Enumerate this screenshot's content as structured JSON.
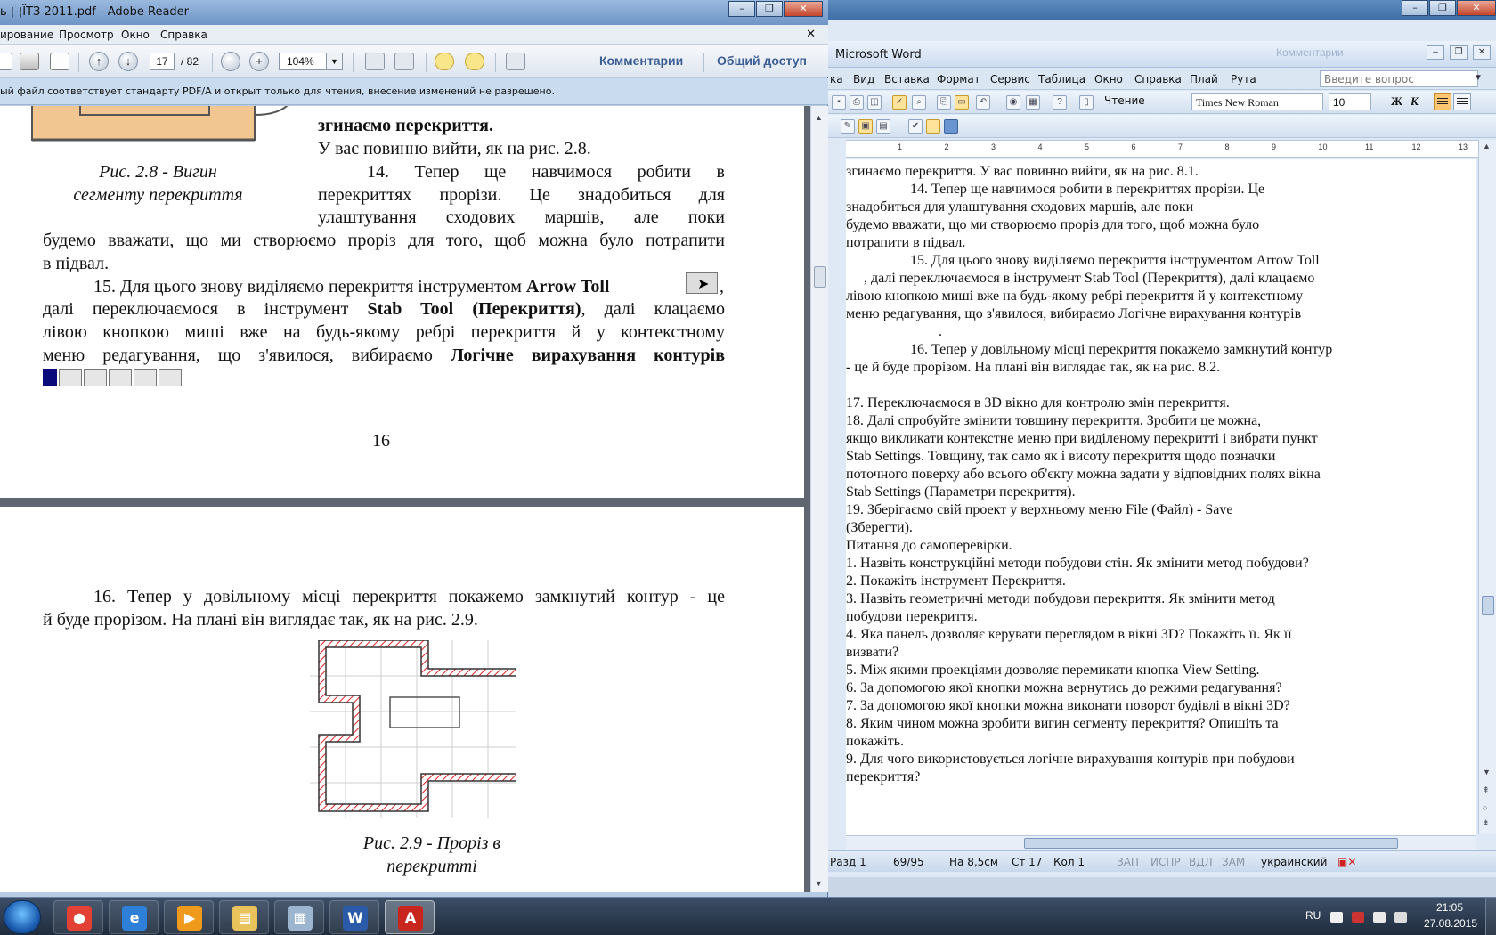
{
  "word": {
    "title": "Microsoft Word",
    "ghost_label": "Комментарии",
    "question_placeholder": "Введите вопрос",
    "menu": [
      "ка",
      "Вид",
      "Вставка",
      "Формат",
      "Сервис",
      "Таблица",
      "Окно",
      "Справка",
      "Плай",
      "Рута"
    ],
    "reading_label": "Чтение",
    "font_name": "Times New Roman",
    "font_size": "10",
    "bold_label": "Ж",
    "italic_label": "К",
    "ruler": [
      "1",
      "2",
      "3",
      "4",
      "5",
      "6",
      "7",
      "8",
      "9",
      "10",
      "11",
      "12",
      "13"
    ],
    "doc_lines": [
      {
        "text": "згинаємо перекриття. У вас повинно вийти, як на рис. 8.1.",
        "indent": false
      },
      {
        "text": "14. Тепер ще навчимося робити в перекриттях прорізи. Це",
        "indent": true
      },
      {
        "text": "знадобиться для улаштування сходових маршів, але поки",
        "indent": false
      },
      {
        "text": "будемо вважати, що ми створюємо проріз для того, щоб можна було",
        "indent": false
      },
      {
        "text": "потрапити в підвал.",
        "indent": false
      },
      {
        "text": "15. Для цього знову виділяємо перекриття інструментом Arrow Toll",
        "indent": true
      },
      {
        "text": "     , далі переключаємося в інструмент Stab Tool (Перекриття), далі клацаємо",
        "indent": false
      },
      {
        "text": "лівою кнопкою миші вже на будь-якому ребрі перекриття й у контекстному",
        "indent": false
      },
      {
        "text": "меню редагування, що з'явилося, вибираємо Логічне вирахування контурів",
        "indent": false
      },
      {
        "text": "                          .",
        "indent": false
      },
      {
        "text": "16. Тепер у довільному місці перекриття покажемо замкнутий контур",
        "indent": true
      },
      {
        "text": "- це й буде прорізом. На плані він виглядає так, як на рис. 8.2.",
        "indent": false
      },
      {
        "text": "",
        "indent": false
      },
      {
        "text": "17. Переключаємося в 3D вікно для контролю змін перекриття.",
        "indent": false
      },
      {
        "text": "18. Далі спробуйте змінити товщину перекриття. Зробити це можна,",
        "indent": false
      },
      {
        "text": "якщо викликати контекстне меню при виділеному перекритті і вибрати пункт",
        "indent": false
      },
      {
        "text": "Stab Settings. Товщину, так само як і висоту перекриття щодо позначки",
        "indent": false
      },
      {
        "text": "поточного поверху або всього об'єкту можна задати у відповідних полях вікна",
        "indent": false
      },
      {
        "text": "Stab Settings (Параметри перекриття).",
        "indent": false
      },
      {
        "text": "19. Зберігаємо свій проект у верхньому меню File (Файл) - Save",
        "indent": false
      },
      {
        "text": "(Зберегти).",
        "indent": false
      },
      {
        "text": "Питання до самоперевірки.",
        "indent": false
      },
      {
        "text": "1. Назвіть конструкційні методи побудови стін. Як змінити метод побудови?",
        "indent": false
      },
      {
        "text": "2. Покажіть інструмент Перекриття.",
        "indent": false
      },
      {
        "text": "3. Назвіть геометричні методи побудови перекриття. Як змінити метод",
        "indent": false
      },
      {
        "text": "побудови перекриття.",
        "indent": false
      },
      {
        "text": "4. Яка панель дозволяє керувати переглядом в вікні 3D? Покажіть її. Як її",
        "indent": false
      },
      {
        "text": "визвати?",
        "indent": false
      },
      {
        "text": "5. Між якими проекціями дозволяє перемикати кнопка View Setting.",
        "indent": false
      },
      {
        "text": "6. За допомогою якої кнопки можна вернутись до режими редагування?",
        "indent": false
      },
      {
        "text": "7. За допомогою якої кнопки можна виконати поворот будівлі в вікні 3D?",
        "indent": false
      },
      {
        "text": "8. Яким чином можна зробити вигин сегменту перекриття? Опишіть та",
        "indent": false
      },
      {
        "text": "покажіть.",
        "indent": false
      },
      {
        "text": "9. Для чого використовується логічне вирахування контурів при побудови",
        "indent": false
      },
      {
        "text": "перекриття?",
        "indent": false
      }
    ],
    "status": {
      "section": "Разд 1",
      "pages": "69/95",
      "at": "На 8,5см",
      "line": "Ст 17",
      "col": "Кол 1",
      "rec": "ЗАП",
      "trk": "ИСПР",
      "ext": "ВДЛ",
      "ovr": "ЗАМ",
      "lang": "украинский"
    }
  },
  "reader": {
    "title": "ь ¦-¦ЇТЗ 2011.pdf - Adobe Reader",
    "menu": [
      "ирование",
      "Просмотр",
      "Окно",
      "Справка"
    ],
    "page_current": "17",
    "page_total": "/ 82",
    "zoom": "104%",
    "comments_label": "Комментарии",
    "share_label": "Общий доступ",
    "info_text": "ый файл соответствует стандарту PDF/A и открыт только для чтения, внесение изменений не разрешено.",
    "page16": {
      "l1": "згинаємо перекриття.",
      "l2": "У вас повинно вийти, як на рис. 2.8.",
      "cap1": "Рис. 2.8 - Вигин",
      "cap2": "сегменту перекриття",
      "l3": "14. Тепер ще навчимося робити в",
      "l4": "перекриттях прорізи. Це знадобиться для",
      "l5": "улаштування сходових маршів, але поки",
      "l6": "будемо вважати, що ми створюємо проріз для того, щоб можна було потрапити",
      "l7": "в підвал.",
      "l8a": "15. Для цього знову виділяємо перекриття інструментом",
      "l8b": "Arrow Toll",
      "l9a": "далі переключаємося в інструмент",
      "l9b": "Stab Tool (Перекриття)",
      "l9c": ", далі клацаємо",
      "l10": "лівою кнопкою миші вже на будь-якому ребрі перекриття й у контекстному",
      "l11a": "меню редагування, що з'явилося, вибираємо",
      "l11b": "Логічне вирахування контурів",
      "page_num": "16"
    },
    "page17": {
      "l1": "16. Тепер у довільному місці перекриття покажемо замкнутий контур - це",
      "l2": "й буде прорізом. На плані він виглядає так, як на рис. 2.9.",
      "cap1": "Рис. 2.9 - Проріз в",
      "cap2": "перекритті"
    }
  },
  "taskbar": {
    "apps": [
      {
        "name": "chrome",
        "glyph": "●",
        "color": "#e34133"
      },
      {
        "name": "ie",
        "glyph": "e",
        "color": "#2e7fd8"
      },
      {
        "name": "media",
        "glyph": "▶",
        "color": "#f09a1b"
      },
      {
        "name": "explorer",
        "glyph": "▤",
        "color": "#e8c25a"
      },
      {
        "name": "calculator",
        "glyph": "▦",
        "color": "#9db6cf"
      },
      {
        "name": "word",
        "glyph": "W",
        "color": "#2b5aa8"
      },
      {
        "name": "reader",
        "glyph": "A",
        "color": "#c8261d"
      }
    ],
    "lang": "RU",
    "time": "21:05",
    "date": "27.08.2015"
  }
}
